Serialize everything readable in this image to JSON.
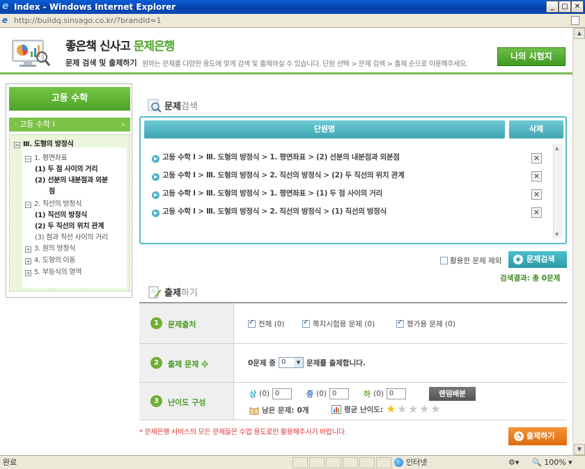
{
  "window": {
    "title": "Index - Windows Internet Explorer",
    "url": "http://buildq.sinsago.co.kr/?brandId=1",
    "status": "완료",
    "zone": "인터넷",
    "zoom": "100%"
  },
  "header": {
    "brand_a": "좋은책",
    "brand_b": "신사고",
    "brand_c": "문제은행",
    "subtitle": "문제 검색 및 출제하기",
    "description": "원하는 문제를 다양한 용도에 맞게 검색 및 출제하실 수 있습니다. 단원 선택 > 문제 검색 > 출제 순으로 이용해주세요.",
    "my_test_button": "나의 시험지"
  },
  "sidebar": {
    "title": "고등 수학",
    "course": "고등 수학 Ⅰ",
    "course_chevron": "›",
    "tree": [
      {
        "label": "Ⅲ. 도형의 방정식",
        "box": "−",
        "bold": true
      },
      {
        "label": "1. 평면좌표",
        "box": "−"
      },
      {
        "label": "(1) 두 점 사이의 거리",
        "bold": true
      },
      {
        "label": "(2) 선분의 내분점과 외분",
        "bold": true
      },
      {
        "label": "점",
        "bold": true
      },
      {
        "label": "2. 직선의 방정식",
        "box": "−"
      },
      {
        "label": "(1) 직선의 방정식",
        "bold": true
      },
      {
        "label": "(2) 두 직선의 위치 관계",
        "bold": true
      },
      {
        "label": "(3) 점과 직선 사이의 거리"
      },
      {
        "label": "3. 원의 방정식",
        "box": "+"
      },
      {
        "label": "4. 도형의 이동",
        "box": "+"
      },
      {
        "label": "5. 부등식의 영역",
        "box": "+"
      }
    ]
  },
  "search": {
    "heading_a": "문제",
    "heading_b": "검색",
    "col_unit": "단원명",
    "col_delete": "삭제",
    "units": [
      "고등 수학 Ⅰ > Ⅲ. 도형의 방정식 > 1. 평면좌표 > (2) 선분의 내분점과 외분점",
      "고등 수학 Ⅰ > Ⅲ. 도형의 방정식 > 2. 직선의 방정식 > (2) 두 직선의 위치 관계",
      "고등 수학 Ⅰ > Ⅲ. 도형의 방정식 > 1. 평면좌표 > (1) 두 점 사이의 거리",
      "고등 수학 Ⅰ > Ⅲ. 도형의 방정식 > 2. 직선의 방정식 > (1) 직선의 방정식"
    ],
    "delete_glyph": "✕",
    "exclude_label": "활용한 문제 제외",
    "search_button": "문제검색",
    "result": "검색결과: 총 0문제"
  },
  "quiz": {
    "heading_a": "출제",
    "heading_b": "하기",
    "rows": {
      "source": {
        "num": "1",
        "label": "문제출처"
      },
      "count": {
        "num": "2",
        "label": "출제 문제 수"
      },
      "difficulty": {
        "num": "3",
        "label": "난이도 구성"
      }
    },
    "sources": [
      {
        "label": "전체 (0)",
        "checked": true
      },
      {
        "label": "쪽지시험용 문제 (0)",
        "checked": true
      },
      {
        "label": "평가용 문제 (0)",
        "checked": true
      }
    ],
    "count_prefix": "0문제 중",
    "count_value": "0",
    "count_suffix": "문제를 출제합니다.",
    "diff_high": "상",
    "diff_high_count": "(0)",
    "diff_high_value": "0",
    "diff_mid": "중",
    "diff_mid_count": "(0)",
    "diff_mid_value": "0",
    "diff_low": "하",
    "diff_low_count": "(0)",
    "diff_low_value": "0",
    "random_button": "랜덤배분",
    "remaining_label": "남은 문제:",
    "remaining_value": "0개",
    "avg_label": "평균 난이도:",
    "avg_stars": 1,
    "star_total": 5,
    "notice": "* 문제은행 서비스의 모든 문제들은 수업 용도로만 활용해주시기 바랍니다.",
    "make_button": "출제하기"
  },
  "colors": {
    "green": "#4aa528",
    "teal": "#56bcc6",
    "orange": "#e06a0e",
    "red": "#e03232"
  }
}
